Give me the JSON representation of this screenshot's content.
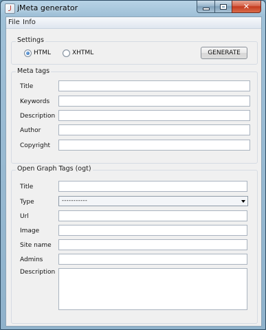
{
  "window": {
    "title": "jMeta generator"
  },
  "menu": [
    "File",
    "Info"
  ],
  "settings": {
    "title": "Settings",
    "format_options": [
      {
        "label": "HTML",
        "checked": true
      },
      {
        "label": "XHTML",
        "checked": false
      }
    ],
    "generate_label": "GENERATE"
  },
  "meta_tags": {
    "title": "Meta tags",
    "fields": [
      {
        "label": "Title",
        "value": ""
      },
      {
        "label": "Keywords",
        "value": ""
      },
      {
        "label": "Description",
        "value": ""
      },
      {
        "label": "Author",
        "value": ""
      },
      {
        "label": "Copyright",
        "value": ""
      }
    ]
  },
  "og_tags": {
    "title": "Open Graph Tags (ogt)",
    "title_label": "Title",
    "type_label": "Type",
    "type_selected": "-----------",
    "url_label": "Url",
    "image_label": "Image",
    "site_name_label": "Site name",
    "admins_label": "Admins",
    "description_label": "Description"
  }
}
